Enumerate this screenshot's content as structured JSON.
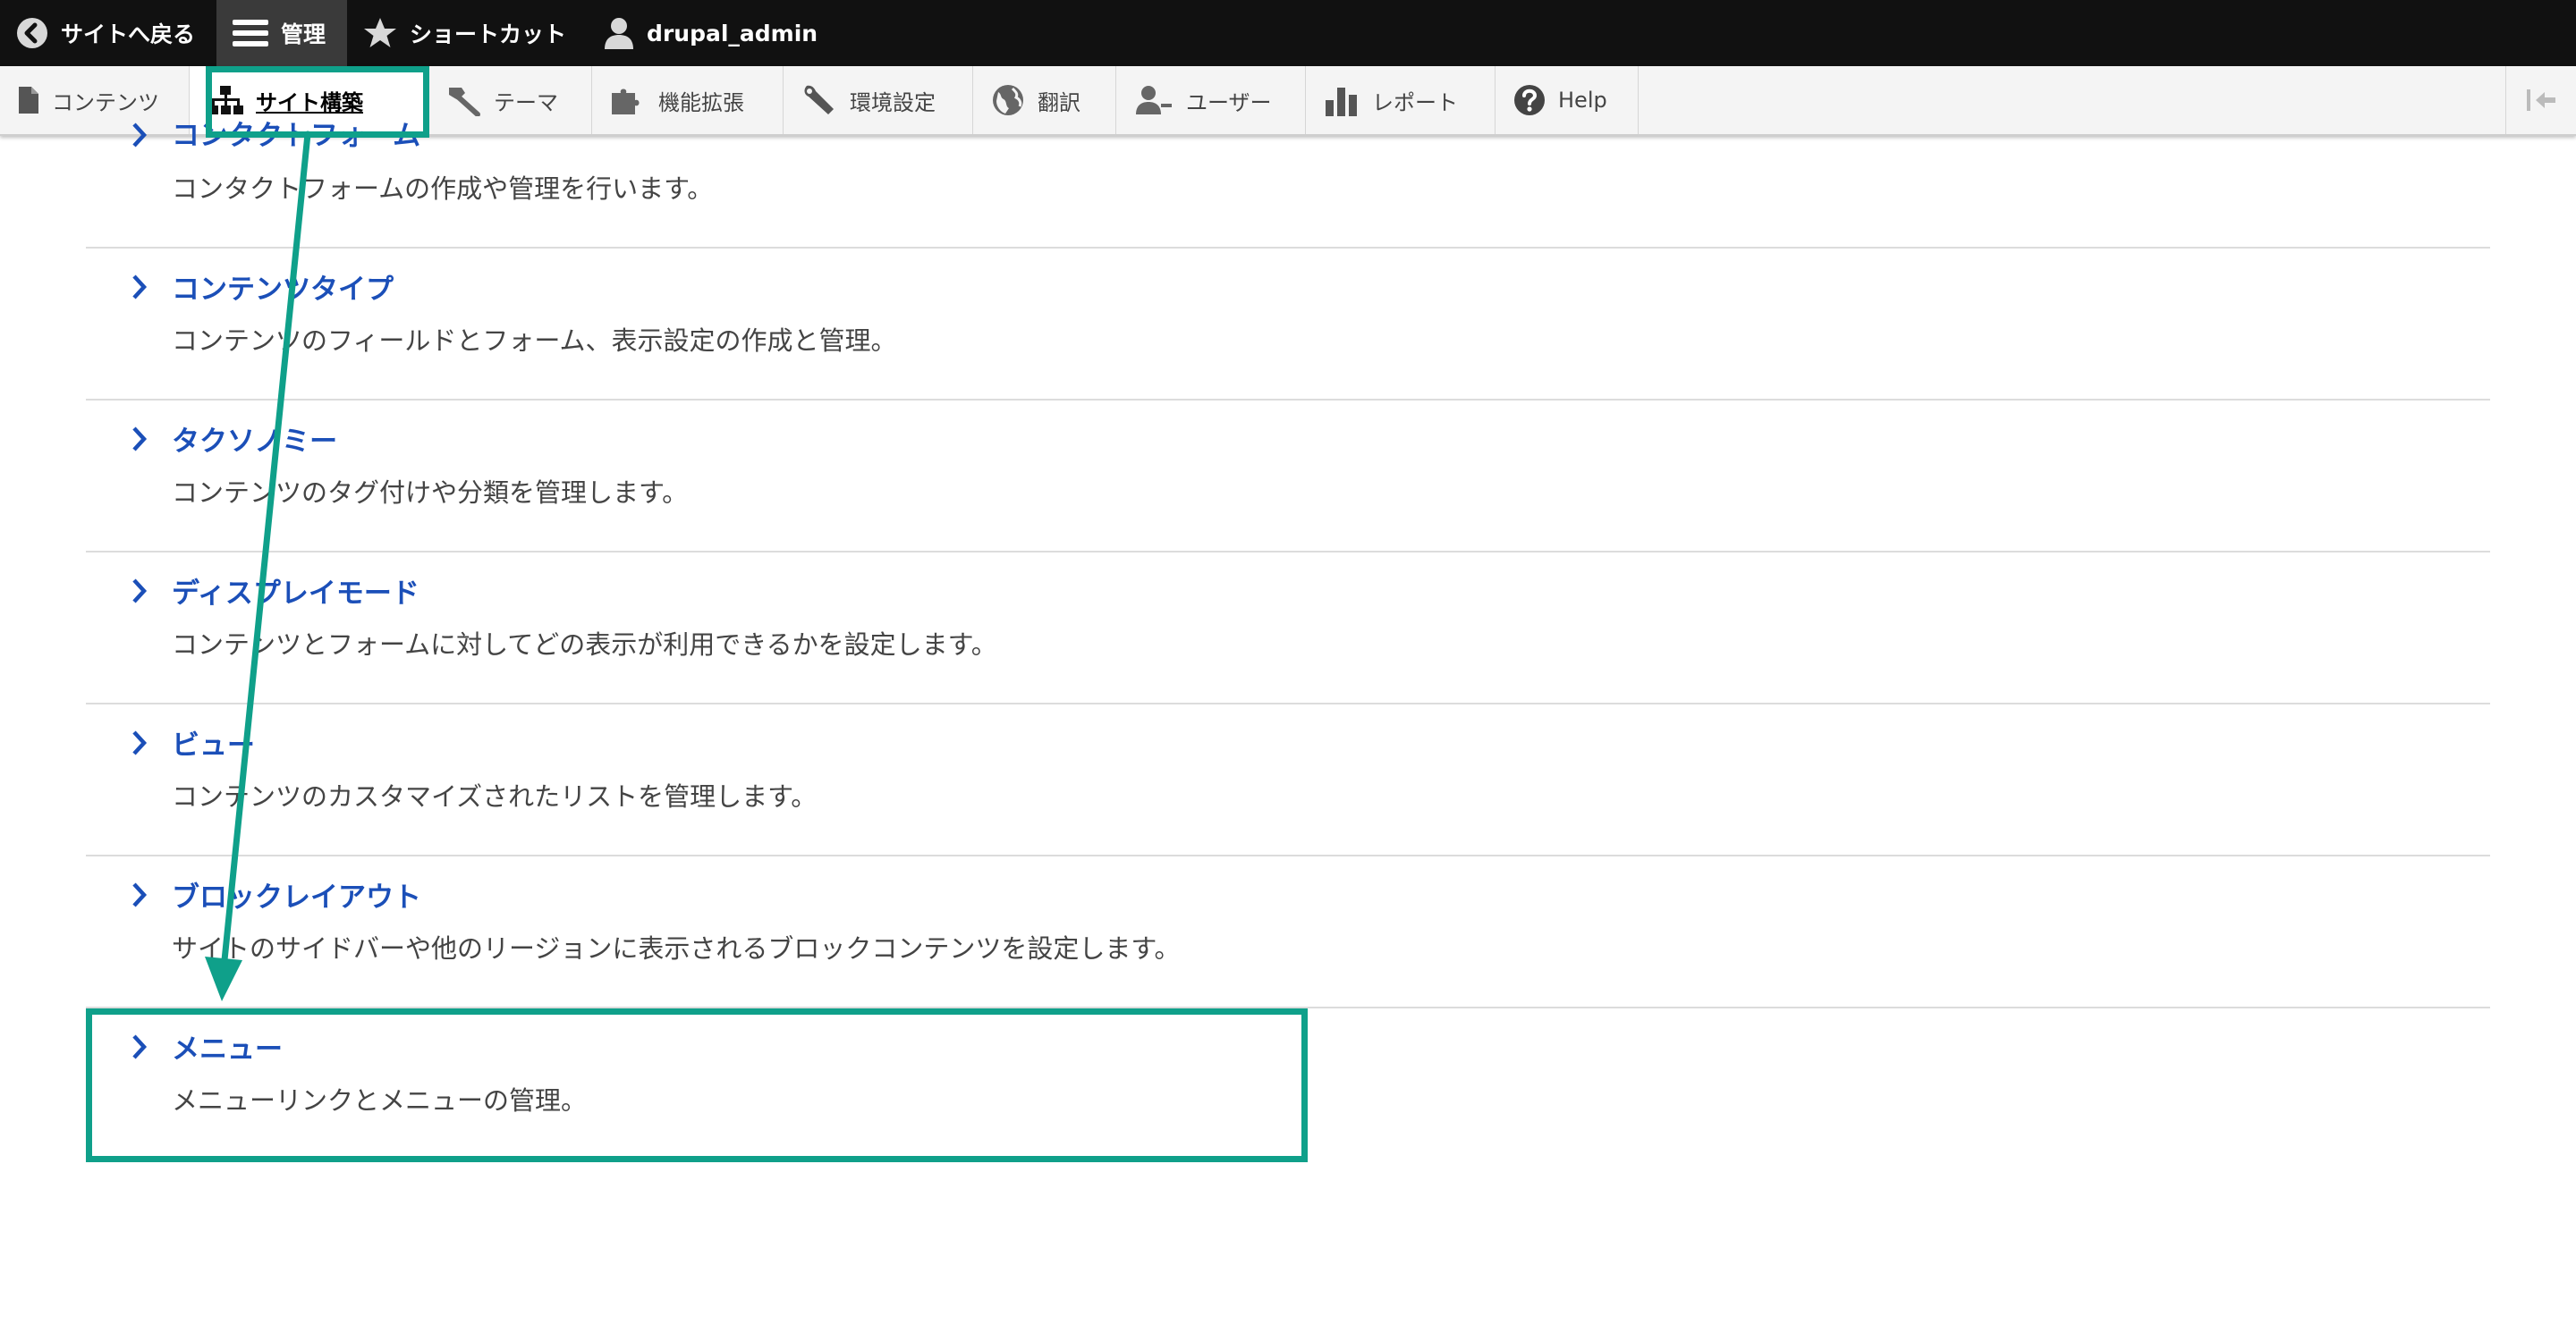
{
  "toolbar": {
    "back_label": "サイトへ戻る",
    "manage_label": "管理",
    "shortcuts_label": "ショートカット",
    "user_label": "drupal_admin"
  },
  "tray": {
    "items": [
      {
        "label": "コンテンツ",
        "icon": "page-icon"
      },
      {
        "label": "サイト構築",
        "icon": "sitemap-icon"
      },
      {
        "label": "テーマ",
        "icon": "paintbrush-icon"
      },
      {
        "label": "機能拡張",
        "icon": "puzzle-icon"
      },
      {
        "label": "環境設定",
        "icon": "wrench-icon"
      },
      {
        "label": "翻訳",
        "icon": "globe-icon"
      },
      {
        "label": "ユーザー",
        "icon": "people-icon"
      },
      {
        "label": "レポート",
        "icon": "bar-chart-icon"
      },
      {
        "label": "Help",
        "icon": "question-icon"
      }
    ],
    "active": "サイト構築"
  },
  "structure_list": [
    {
      "title": "コンタクトフォーム",
      "description": "コンタクトフォームの作成や管理を行います。"
    },
    {
      "title": "コンテンツタイプ",
      "description": "コンテンツのフィールドとフォーム、表示設定の作成と管理。"
    },
    {
      "title": "タクソノミー",
      "description": "コンテンツのタグ付けや分類を管理します。"
    },
    {
      "title": "ディスプレイモード",
      "description": "コンテンツとフォームに対してどの表示が利用できるかを設定します。"
    },
    {
      "title": "ビュー",
      "description": "コンテンツのカスタマイズされたリストを管理します。"
    },
    {
      "title": "ブロックレイアウト",
      "description": "サイトのサイドバーや他のリージョンに表示されるブロックコンテンツを設定します。"
    },
    {
      "title": "メニュー",
      "description": "メニューリンクとメニューの管理。"
    }
  ],
  "colors": {
    "annotation": "#0fa08a",
    "link": "#1b4fb8",
    "toolbar_bg": "#111111"
  }
}
